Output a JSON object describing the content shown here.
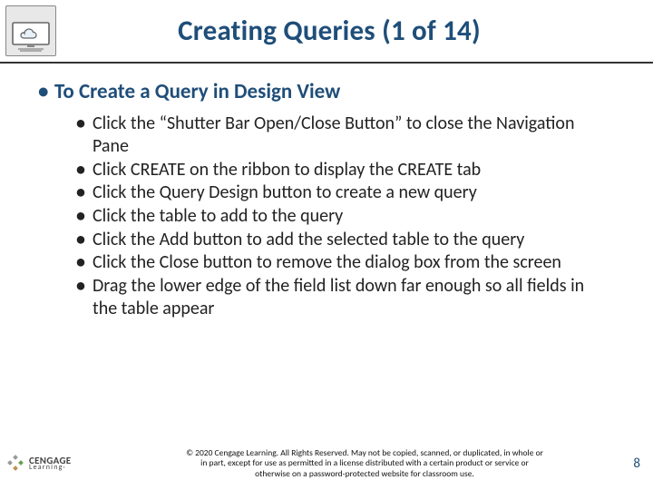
{
  "title": "Creating Queries (1 of 14)",
  "subhead": "To Create a Query in Design View",
  "steps": [
    "Click the “Shutter Bar Open/Close Button” to close the Navigation Pane",
    "Click CREATE on the ribbon to display the CREATE tab",
    "Click the Query Design button to create a new query",
    "Click the table to add to the query",
    "Click the Add button to add the selected table to the query",
    "Click the Close button to remove the dialog box from the screen",
    "Drag the lower edge of the field list down far enough so all fields in the table appear"
  ],
  "logo": {
    "name": "CENGAGE",
    "sub": "Learning·"
  },
  "copyright": "© 2020 Cengage Learning. All Rights Reserved. May not be copied, scanned, or duplicated, in whole or\nin part, except for use as permitted in a license distributed with a certain product or service or\notherwise on a password-protected website for classroom use.",
  "page_number": "8"
}
